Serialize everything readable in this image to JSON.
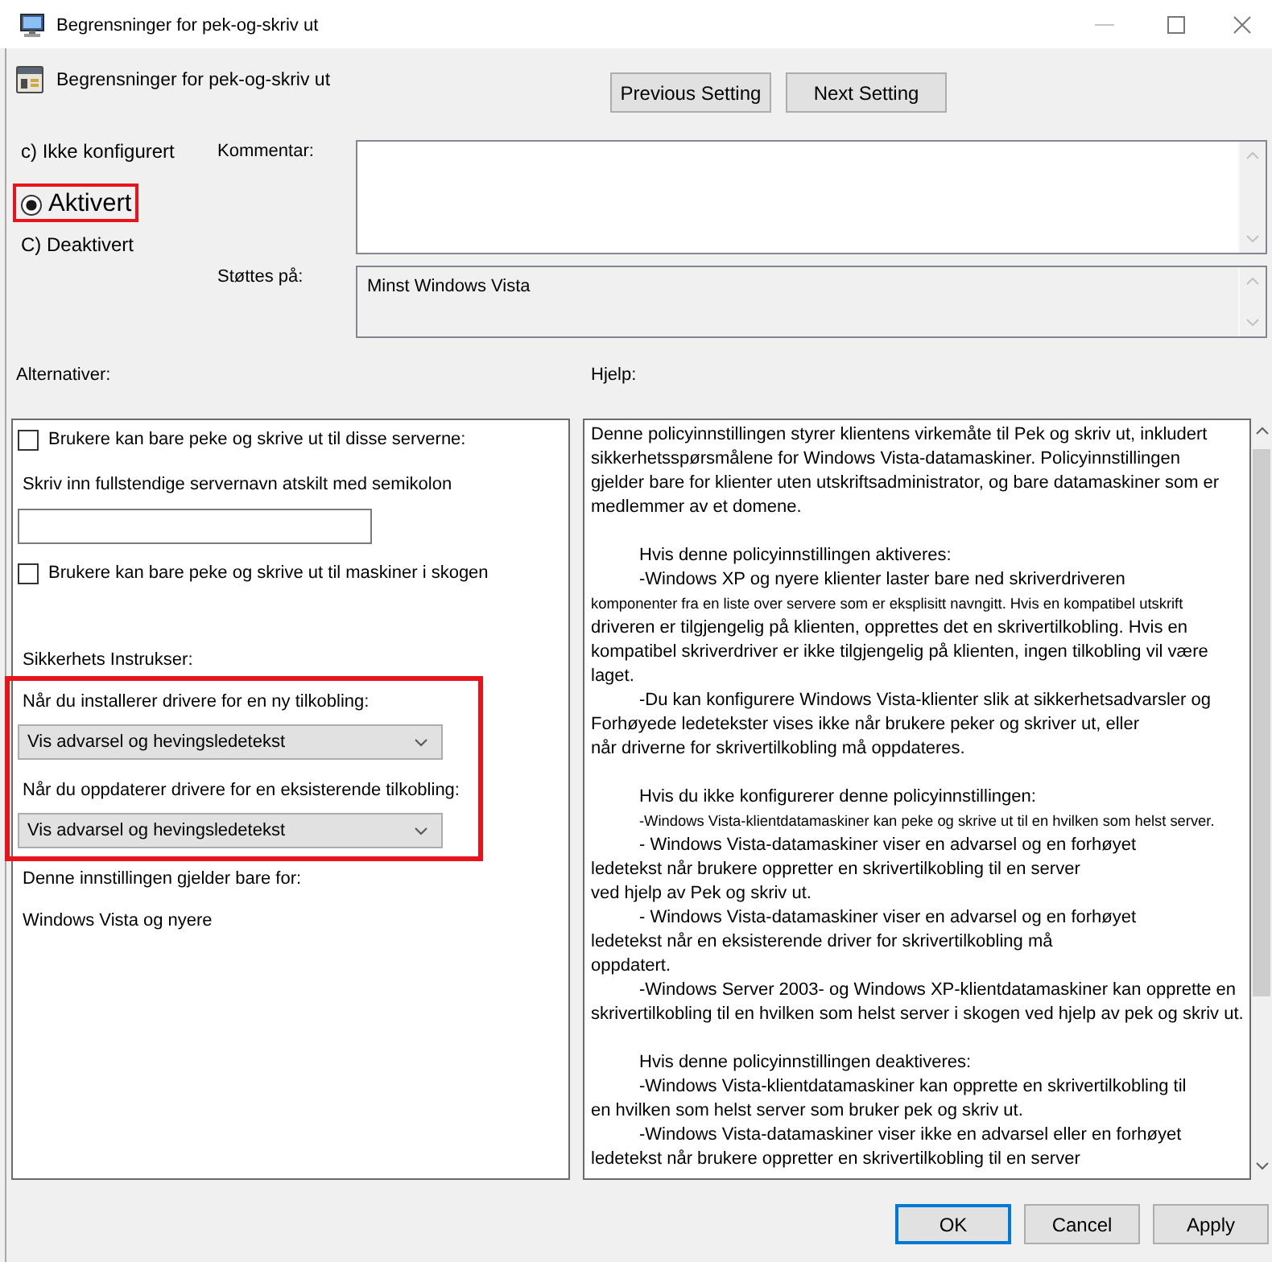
{
  "window": {
    "title": "Begrensninger for pek-og-skriv ut"
  },
  "header": {
    "title": "Begrensninger for pek-og-skriv ut",
    "buttons": [
      "Previous Setting",
      "Next Setting"
    ]
  },
  "state_options": [
    {
      "label": "c) Ikke konfigurert",
      "kind": "text",
      "selected": false,
      "highlighted": false
    },
    {
      "label": "Aktivert",
      "kind": "radio",
      "selected": true,
      "highlighted": true
    },
    {
      "label": "C) Deaktivert",
      "kind": "text",
      "selected": false,
      "highlighted": false
    }
  ],
  "comment": {
    "label": "Kommentar:"
  },
  "supported_on": {
    "label": "Støttes på:",
    "value": "Minst Windows Vista"
  },
  "options": {
    "label": "Alternativer:",
    "items": [
      {
        "kind": "checkbox",
        "label": "Brukere kan bare peke og skrive ut til disse serverne:",
        "checked": false
      },
      {
        "kind": "text",
        "label": "Skriv inn fullstendige servernavn atskilt med semikolon"
      },
      {
        "kind": "input"
      },
      {
        "kind": "checkbox",
        "label": "Brukere kan bare peke og skrive ut til maskiner i skogen",
        "checked": false
      },
      {
        "kind": "heading",
        "label": "Sikkerhets Instrukser:"
      },
      {
        "kind": "group",
        "highlighted": true,
        "items": [
          {
            "kind": "text",
            "label": "Når du installerer drivere for en ny tilkobling:"
          },
          {
            "kind": "dropdown",
            "value": "Vis advarsel og hevingsledetekst"
          },
          {
            "kind": "text",
            "label": "Når du oppdaterer drivere for en eksisterende tilkobling:"
          },
          {
            "kind": "dropdown",
            "value": "Vis advarsel og hevingsledetekst"
          }
        ]
      },
      {
        "kind": "text",
        "label": "Denne innstillingen gjelder bare for:"
      },
      {
        "kind": "text",
        "label": "Windows Vista og nyere"
      }
    ]
  },
  "help": {
    "label": "Hjelp:",
    "sections": [
      {
        "items": [
          {
            "indent": false,
            "lines": [
              {
                "text": "Denne policyinnstillingen styrer klientens virkemåte til Pek og skriv ut, inkludert",
                "small": false
              },
              {
                "text": "sikkerhetsspørsmålene for Windows Vista-datamaskiner. Policyinnstillingen",
                "small": false
              },
              {
                "text": "gjelder bare for klienter uten utskriftsadministrator, og bare datamaskiner som er",
                "small": false
              },
              {
                "text": "medlemmer av et domene.",
                "small": false
              }
            ]
          }
        ]
      },
      {
        "items": [
          {
            "indent": true,
            "lines": [
              {
                "text": "Hvis denne policyinnstillingen aktiveres:",
                "small": false
              }
            ]
          },
          {
            "indent": true,
            "lines": [
              {
                "text": "-Windows XP og nyere klienter laster bare ned skriverdriveren",
                "small": false
              },
              {
                "text": "komponenter fra en liste over servere som er eksplisitt navngitt. Hvis en kompatibel utskrift",
                "small": true
              },
              {
                "text": "driveren er tilgjengelig på klienten, opprettes det en skrivertilkobling. Hvis en",
                "small": false
              },
              {
                "text": "kompatibel skriverdriver er ikke tilgjengelig på klienten, ingen tilkobling vil være",
                "small": false
              },
              {
                "text": "laget.",
                "small": false
              }
            ]
          },
          {
            "indent": true,
            "lines": [
              {
                "text": "-Du kan konfigurere Windows Vista-klienter slik at sikkerhetsadvarsler og",
                "small": false
              },
              {
                "text": "Forhøyede ledetekster vises ikke når brukere peker og skriver ut, eller",
                "small": false
              },
              {
                "text": "når driverne for skrivertilkobling må oppdateres.",
                "small": false
              }
            ]
          }
        ]
      },
      {
        "items": [
          {
            "indent": true,
            "lines": [
              {
                "text": "Hvis du ikke konfigurerer denne policyinnstillingen:",
                "small": false
              }
            ]
          },
          {
            "indent": true,
            "lines": [
              {
                "text": "-Windows Vista-klientdatamaskiner kan peke og skrive ut til en hvilken som helst server.",
                "small": true
              }
            ]
          },
          {
            "indent": true,
            "lines": [
              {
                "text": "- Windows Vista-datamaskiner viser en advarsel og en forhøyet",
                "small": false
              },
              {
                "text": "ledetekst når brukere oppretter en skrivertilkobling til en server",
                "small": false
              },
              {
                "text": "ved hjelp av Pek og skriv ut.",
                "small": false
              }
            ]
          },
          {
            "indent": true,
            "lines": [
              {
                "text": "- Windows Vista-datamaskiner viser en advarsel og en forhøyet",
                "small": false
              },
              {
                "text": "ledetekst når en eksisterende driver for skrivertilkobling må",
                "small": false
              },
              {
                "text": "oppdatert.",
                "small": false
              }
            ]
          },
          {
            "indent": true,
            "lines": [
              {
                "text": "-Windows Server 2003- og Windows XP-klientdatamaskiner kan opprette en",
                "small": false
              },
              {
                "text": "skrivertilkobling til en hvilken som helst server i skogen ved hjelp av pek og skriv ut.",
                "small": false
              }
            ]
          }
        ]
      },
      {
        "items": [
          {
            "indent": true,
            "lines": [
              {
                "text": "Hvis denne policyinnstillingen deaktiveres:",
                "small": false
              }
            ]
          },
          {
            "indent": true,
            "lines": [
              {
                "text": "-Windows Vista-klientdatamaskiner kan opprette en skrivertilkobling til",
                "small": false
              },
              {
                "text": "en hvilken som helst server som bruker pek og skriv ut.",
                "small": false
              }
            ]
          },
          {
            "indent": true,
            "lines": [
              {
                "text": "-Windows Vista-datamaskiner viser ikke en advarsel eller en forhøyet",
                "small": false
              },
              {
                "text": "ledetekst når brukere oppretter en skrivertilkobling til en server",
                "small": false
              }
            ]
          }
        ]
      }
    ]
  },
  "buttons": [
    {
      "label": "OK",
      "default": true
    },
    {
      "label": "Cancel",
      "default": false
    },
    {
      "label": "Apply",
      "default": false
    }
  ]
}
